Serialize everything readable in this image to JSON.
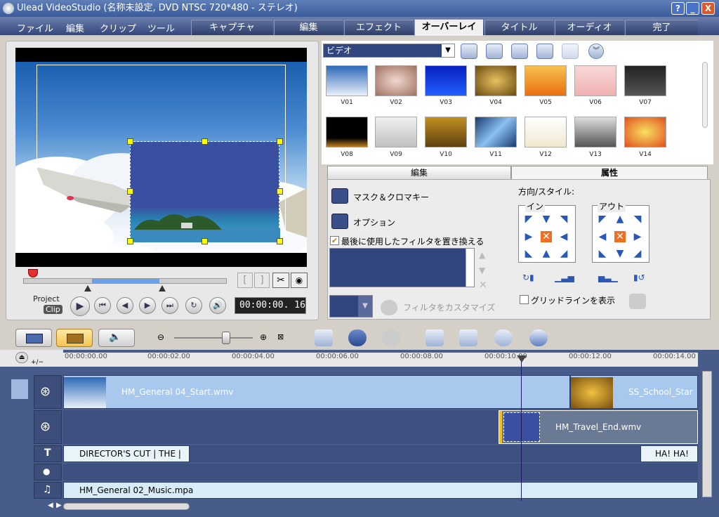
{
  "window": {
    "title": "Ulead VideoStudio (名称未設定, DVD NTSC 720*480 - ステレオ)",
    "help_label": "?",
    "minimize_label": "_",
    "close_label": "X"
  },
  "menu": {
    "items": [
      "ファイル",
      "編集",
      "クリップ",
      "ツール"
    ]
  },
  "steps": [
    {
      "label": "キャプチャ"
    },
    {
      "label": "編集"
    },
    {
      "label": "エフェクト"
    },
    {
      "label": "オーバーレイ",
      "active": true
    },
    {
      "label": "タイトル"
    },
    {
      "label": "オーディオ"
    },
    {
      "label": "完了"
    }
  ],
  "preview": {
    "mode_project": "Project",
    "mode_clip": "Clip",
    "timecode": "00:00:00. 16",
    "mark_in": "[",
    "mark_out": "]"
  },
  "library": {
    "category": "ビデオ",
    "thumbs": [
      "V01",
      "V02",
      "V03",
      "V04",
      "V05",
      "V06",
      "V07",
      "V08",
      "V09",
      "V10",
      "V11",
      "V12",
      "V13",
      "V14"
    ]
  },
  "options": {
    "tab_edit": "編集",
    "tab_attr": "属性",
    "mask_label": "マスク＆クロマキー",
    "option_label": "オプション",
    "replace_filter_label": "最後に使用したフィルタを置き換える",
    "customize_filter_label": "フィルタをカスタマイズ",
    "direction_label": "方向/スタイル:",
    "in_label": "イン",
    "out_label": "アウト",
    "gridline_label": "グリッドラインを表示",
    "replace_filter_checked": true,
    "gridline_checked": false
  },
  "timeline": {
    "ticks": [
      "00:00:00.00",
      "00:00:02.00",
      "00:00:04.00",
      "00:00:06.00",
      "00:00:08.00",
      "00:00:10.00",
      "00:00:12.00",
      "00:00:14.00"
    ],
    "video_clip_1": "HM_General 04_Start.wmv",
    "video_clip_2": "SS_School_Star",
    "overlay_clip": "HM_Travel_End.wmv",
    "title_clip_1": "DIRECTOR'S CUT | THE |",
    "title_clip_2": "HA!  HA!",
    "music_clip": "HM_General 02_Music.mpa",
    "add_remove": "+/−"
  },
  "colors": {
    "tab_active_bg": "#f0f0f0",
    "timeline_bg": "#485c8a",
    "track_light": "#a8c8ee",
    "handle": "#ffff00"
  }
}
